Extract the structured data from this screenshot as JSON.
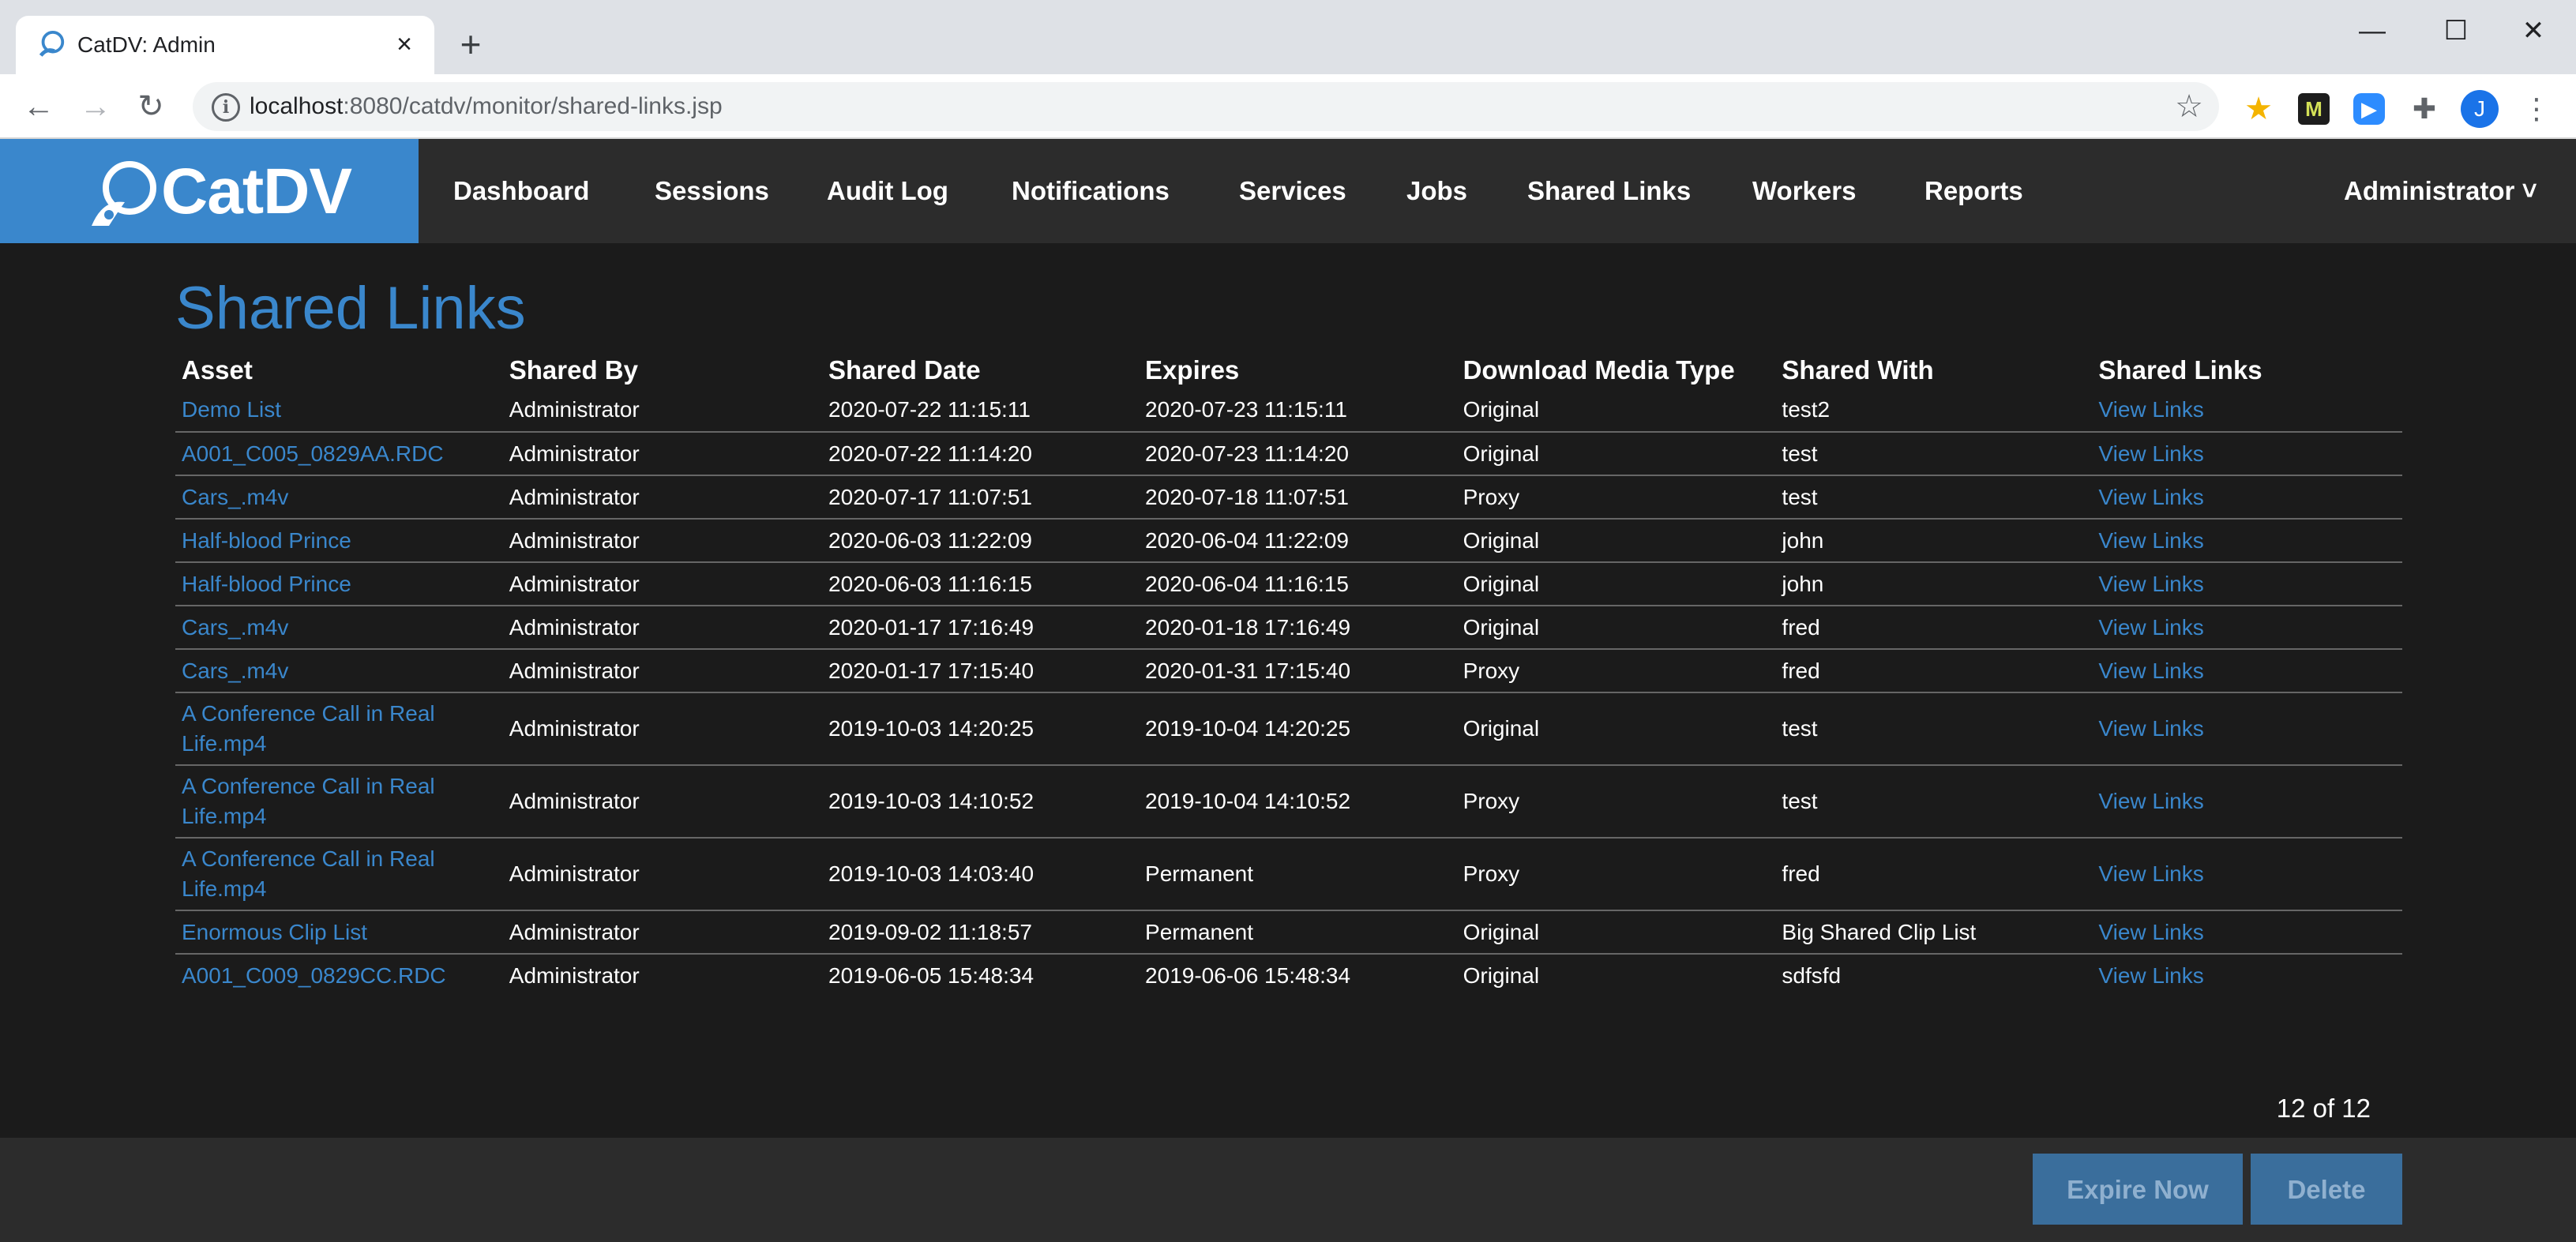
{
  "browser": {
    "tab_title": "CatDV: Admin",
    "tab_close": "×",
    "new_tab": "+",
    "url_host": "localhost",
    "url_path": ":8080/catdv/monitor/shared-links.jsp",
    "profile_initial": "J",
    "ext_m_label": "M",
    "window_controls": {
      "minimize": "—",
      "maximize": "☐",
      "close": "✕"
    }
  },
  "app": {
    "brand": "CatDV",
    "nav": [
      "Dashboard",
      "Sessions",
      "Audit Log",
      "Notifications",
      "Services",
      "Jobs",
      "Shared Links",
      "Workers",
      "Reports"
    ],
    "user_menu": "Administrator ˅",
    "accent_color": "#3a87cc"
  },
  "page": {
    "title": "Shared Links",
    "columns": [
      "Asset",
      "Shared By",
      "Shared Date",
      "Expires",
      "Download Media Type",
      "Shared With",
      "Shared Links"
    ],
    "rows": [
      {
        "asset": "Demo List",
        "shared_by": "Administrator",
        "shared_date": "2020-07-22 11:15:11",
        "expires": "2020-07-23 11:15:11",
        "media_type": "Original",
        "shared_with": "test2",
        "links": "View Links"
      },
      {
        "asset": "A001_C005_0829AA.RDC",
        "shared_by": "Administrator",
        "shared_date": "2020-07-22 11:14:20",
        "expires": "2020-07-23 11:14:20",
        "media_type": "Original",
        "shared_with": "test",
        "links": "View Links"
      },
      {
        "asset": "Cars_.m4v",
        "shared_by": "Administrator",
        "shared_date": "2020-07-17 11:07:51",
        "expires": "2020-07-18 11:07:51",
        "media_type": "Proxy",
        "shared_with": "test",
        "links": "View Links"
      },
      {
        "asset": "Half-blood Prince",
        "shared_by": "Administrator",
        "shared_date": "2020-06-03 11:22:09",
        "expires": "2020-06-04 11:22:09",
        "media_type": "Original",
        "shared_with": "john",
        "links": "View Links"
      },
      {
        "asset": "Half-blood Prince",
        "shared_by": "Administrator",
        "shared_date": "2020-06-03 11:16:15",
        "expires": "2020-06-04 11:16:15",
        "media_type": "Original",
        "shared_with": "john",
        "links": "View Links"
      },
      {
        "asset": "Cars_.m4v",
        "shared_by": "Administrator",
        "shared_date": "2020-01-17 17:16:49",
        "expires": "2020-01-18 17:16:49",
        "media_type": "Original",
        "shared_with": "fred",
        "links": "View Links"
      },
      {
        "asset": "Cars_.m4v",
        "shared_by": "Administrator",
        "shared_date": "2020-01-17 17:15:40",
        "expires": "2020-01-31 17:15:40",
        "media_type": "Proxy",
        "shared_with": "fred",
        "links": "View Links"
      },
      {
        "asset": "A Conference Call in Real Life.mp4",
        "shared_by": "Administrator",
        "shared_date": "2019-10-03 14:20:25",
        "expires": "2019-10-04 14:20:25",
        "media_type": "Original",
        "shared_with": "test",
        "links": "View Links"
      },
      {
        "asset": "A Conference Call in Real Life.mp4",
        "shared_by": "Administrator",
        "shared_date": "2019-10-03 14:10:52",
        "expires": "2019-10-04 14:10:52",
        "media_type": "Proxy",
        "shared_with": "test",
        "links": "View Links"
      },
      {
        "asset": "A Conference Call in Real Life.mp4",
        "shared_by": "Administrator",
        "shared_date": "2019-10-03 14:03:40",
        "expires": "Permanent",
        "media_type": "Proxy",
        "shared_with": "fred",
        "links": "View Links"
      },
      {
        "asset": "Enormous Clip List",
        "shared_by": "Administrator",
        "shared_date": "2019-09-02 11:18:57",
        "expires": "Permanent",
        "media_type": "Original",
        "shared_with": "Big Shared Clip List",
        "links": "View Links"
      },
      {
        "asset": "A001_C009_0829CC.RDC",
        "shared_by": "Administrator",
        "shared_date": "2019-06-05 15:48:34",
        "expires": "2019-06-06 15:48:34",
        "media_type": "Original",
        "shared_with": "sdfsfd",
        "links": "View Links"
      }
    ],
    "pagination": "12 of 12",
    "buttons": {
      "expire": "Expire Now",
      "delete": "Delete"
    }
  }
}
